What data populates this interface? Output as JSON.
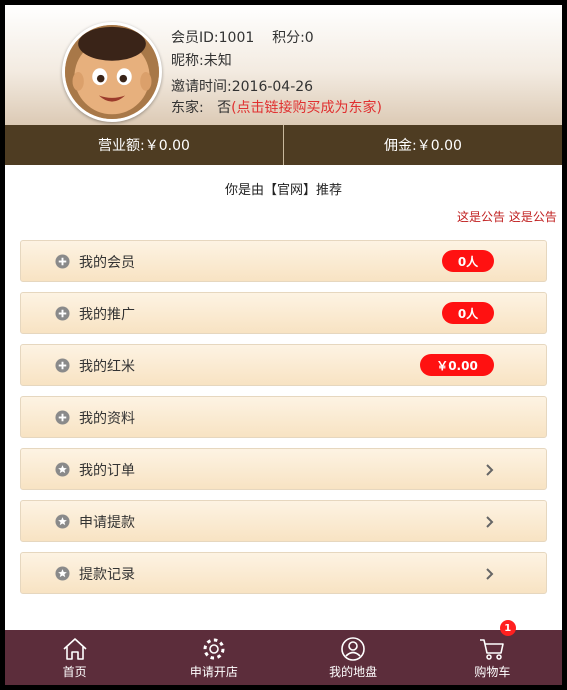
{
  "profile": {
    "member_id": "会员ID:1001",
    "points": "积分:0",
    "nickname": "昵称:未知",
    "invite_time": "邀请时间:2016-04-26",
    "partner_label": "东家:",
    "partner_value": "否",
    "partner_link": "(点击链接购买成为东家)"
  },
  "stats": {
    "revenue": "营业额:￥0.00",
    "commission": "佣金:￥0.00"
  },
  "referral": "你是由【官网】推荐",
  "notice": "这是公告 这是公告",
  "menu": [
    {
      "label": "我的会员",
      "badge": "0人",
      "icon": "plus-circle-icon"
    },
    {
      "label": "我的推广",
      "badge": "0人",
      "icon": "plus-circle-icon"
    },
    {
      "label": "我的红米",
      "badge": "￥0.00",
      "icon": "plus-circle-icon"
    },
    {
      "label": "我的资料",
      "icon": "plus-circle-icon"
    },
    {
      "label": "我的订单",
      "icon": "star-circle-icon",
      "chevron": "chevron-right-icon"
    },
    {
      "label": "申请提款",
      "icon": "star-circle-icon",
      "chevron": "chevron-right-icon"
    },
    {
      "label": "提款记录",
      "icon": "star-circle-icon",
      "chevron": "chevron-right-icon"
    }
  ],
  "tabbar": [
    {
      "label": "首页",
      "icon": "home-icon"
    },
    {
      "label": "申请开店",
      "icon": "gear-icon"
    },
    {
      "label": "我的地盘",
      "icon": "user-circle-icon"
    },
    {
      "label": "购物车",
      "icon": "cart-icon",
      "badge": "1"
    }
  ],
  "colors": {
    "stats_bar": "#4e3c22",
    "tab_bar": "#5c2d3b",
    "badge": "#ff1111",
    "link_red": "#e03030",
    "row_bg": "#f8e3c3"
  }
}
